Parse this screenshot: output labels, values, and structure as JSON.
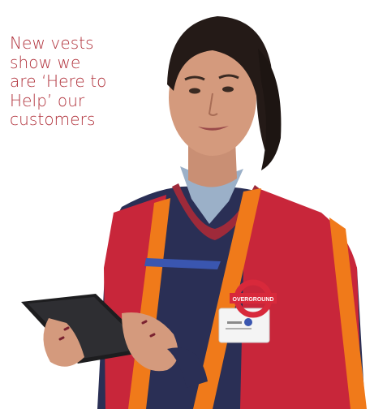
{
  "caption": {
    "lines": [
      "New vests",
      "show we",
      "are ‘Here to",
      "Help’ our",
      "customers"
    ],
    "color": "#b0303a"
  },
  "photo": {
    "subject": "woman in orange-and-red hi-vis vest holding a tablet",
    "vest_colors": {
      "red": "#c8263a",
      "orange": "#f07a1a",
      "jumper": "#2a2f55"
    },
    "badge_text": "OVERGROUND",
    "badge_color": "#d8293b"
  }
}
